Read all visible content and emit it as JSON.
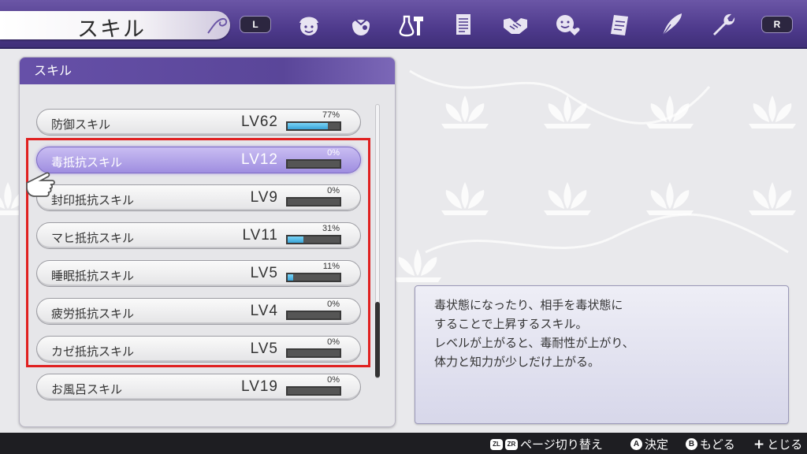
{
  "header": {
    "title": "スキル",
    "left_shoulder": "L",
    "right_shoulder": "R",
    "tabs": [
      {
        "icon": "character-face-icon",
        "active": false
      },
      {
        "icon": "pouch-icon",
        "active": false
      },
      {
        "icon": "skill-flask-hammer-icon",
        "active": true
      },
      {
        "icon": "document-list-icon",
        "active": false
      },
      {
        "icon": "handshake-icon",
        "active": false
      },
      {
        "icon": "smile-heart-icon",
        "active": false
      },
      {
        "icon": "book-icon",
        "active": false
      },
      {
        "icon": "quill-icon",
        "active": false
      },
      {
        "icon": "wrench-icon",
        "active": false
      }
    ]
  },
  "panel": {
    "title": "スキル",
    "skills": [
      {
        "name": "防御スキル",
        "level": "LV62",
        "percent": "77%",
        "progress": 0.77,
        "selected": false
      },
      {
        "name": "毒抵抗スキル",
        "level": "LV12",
        "percent": "0%",
        "progress": 0,
        "selected": true
      },
      {
        "name": "封印抵抗スキル",
        "level": "LV9",
        "percent": "0%",
        "progress": 0,
        "selected": false
      },
      {
        "name": "マヒ抵抗スキル",
        "level": "LV11",
        "percent": "31%",
        "progress": 0.31,
        "selected": false
      },
      {
        "name": "睡眠抵抗スキル",
        "level": "LV5",
        "percent": "11%",
        "progress": 0.11,
        "selected": false
      },
      {
        "name": "疲労抵抗スキル",
        "level": "LV4",
        "percent": "0%",
        "progress": 0,
        "selected": false
      },
      {
        "name": "カゼ抵抗スキル",
        "level": "LV5",
        "percent": "0%",
        "progress": 0,
        "selected": false
      },
      {
        "name": "お風呂スキル",
        "level": "LV19",
        "percent": "0%",
        "progress": 0,
        "selected": false
      }
    ]
  },
  "description": {
    "lines": [
      "毒状態になったり、相手を毒状態に",
      "することで上昇するスキル。",
      "レベルが上がると、毒耐性が上がり、",
      "体力と知力が少しだけ上がる。"
    ]
  },
  "footer": {
    "zl": "ZL",
    "zr": "ZR",
    "page_switch": "ページ切り替え",
    "a_button": "A",
    "confirm": "決定",
    "b_button": "B",
    "back": "もどる",
    "plus": "+",
    "close": "とじる"
  },
  "colors": {
    "header_purple": "#4e3a8c",
    "selected_row": "#9f8ee0",
    "progress_fill": "#3aa4d8",
    "highlight_box": "#e02020"
  }
}
